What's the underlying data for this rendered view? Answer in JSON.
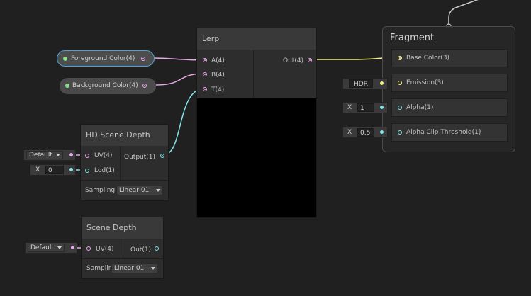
{
  "colors": {
    "bg": "#202020",
    "wire_vector4": "#e8a9e8",
    "wire_vector3": "#f3f08a",
    "wire_float": "#84e4e7",
    "port_vector1": "#84e4e7",
    "port_green": "#8be08b",
    "selection": "#4aa3d8"
  },
  "fragment": {
    "title": "Fragment",
    "ports": [
      {
        "label": "Base Color(3)",
        "type": "vector3"
      },
      {
        "label": "Emission(3)",
        "type": "vector3"
      },
      {
        "label": "Alpha(1)",
        "type": "float"
      },
      {
        "label": "Alpha Clip Threshold(1)",
        "type": "float"
      }
    ],
    "inputs": {
      "emission_tag": "HDR",
      "alpha_axis": "X",
      "alpha_value": "1",
      "clip_axis": "X",
      "clip_value": "0.5"
    }
  },
  "lerp": {
    "title": "Lerp",
    "inputs": [
      "A(4)",
      "B(4)",
      "T(4)"
    ],
    "output": "Out(4)"
  },
  "properties": {
    "foreground": "Foreground Color(4)",
    "background": "Background Color(4)"
  },
  "hd_scene_depth": {
    "title": "HD Scene Depth",
    "inputs": [
      "UV(4)",
      "Lod(1)"
    ],
    "output": "Output(1)",
    "uv_default": "Default",
    "lod_axis": "X",
    "lod_value": "0",
    "sampling_label": "Sampling",
    "sampling_value": "Linear 01"
  },
  "scene_depth": {
    "title": "Scene Depth",
    "inputs": [
      "UV(4)"
    ],
    "output": "Out(1)",
    "uv_default": "Default",
    "sampling_label": "Samplin",
    "sampling_value": "Linear 01"
  }
}
